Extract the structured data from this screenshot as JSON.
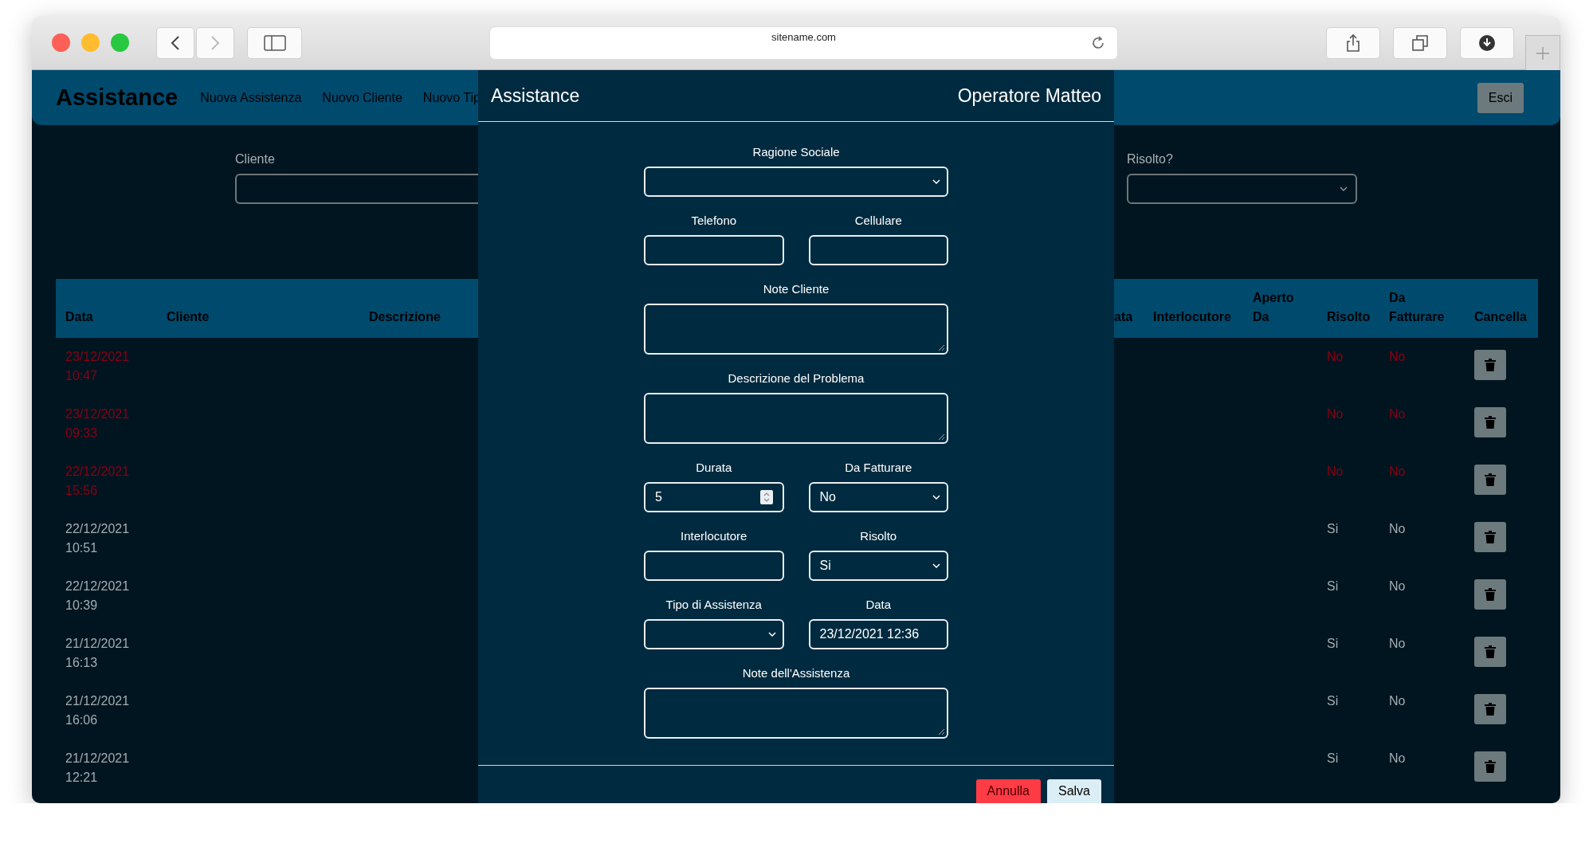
{
  "browser": {
    "url": "sitename.com"
  },
  "navbar": {
    "brand": "Assistance",
    "links": [
      "Nuova Assistenza",
      "Nuovo Cliente",
      "Nuovo Tip"
    ],
    "logout": "Esci"
  },
  "filters": [
    {
      "label": "Cliente",
      "kind": "text"
    },
    {
      "label": "Risolto?",
      "kind": "select"
    }
  ],
  "table": {
    "columns_left": [
      "Data",
      "Cliente",
      "Descrizione"
    ],
    "columns_right": [
      "ata",
      "Interlocutore",
      "Aperto Da",
      "Risolto",
      "Da Fatturare",
      "Cancella"
    ],
    "rows": [
      {
        "data": "23/12/2021 10:47",
        "risolto": "No",
        "da_fatturare": "No",
        "flagged": true
      },
      {
        "data": "23/12/2021 09:33",
        "risolto": "No",
        "da_fatturare": "No",
        "flagged": true
      },
      {
        "data": "22/12/2021 15:56",
        "risolto": "No",
        "da_fatturare": "No",
        "flagged": true
      },
      {
        "data": "22/12/2021 10:51",
        "risolto": "Si",
        "da_fatturare": "No",
        "flagged": false
      },
      {
        "data": "22/12/2021 10:39",
        "risolto": "Si",
        "da_fatturare": "No",
        "flagged": false
      },
      {
        "data": "21/12/2021 16:13",
        "risolto": "Si",
        "da_fatturare": "No",
        "flagged": false
      },
      {
        "data": "21/12/2021 16:06",
        "risolto": "Si",
        "da_fatturare": "No",
        "flagged": false
      },
      {
        "data": "21/12/2021 12:21",
        "risolto": "Si",
        "da_fatturare": "No",
        "flagged": false
      }
    ]
  },
  "modal": {
    "title": "Assistance",
    "operator": "Operatore Matteo",
    "rows": [
      [
        {
          "label": "Ragione Sociale",
          "kind": "select"
        }
      ],
      [
        {
          "label": "Telefono",
          "kind": "text"
        },
        {
          "label": "Cellulare",
          "kind": "text"
        }
      ],
      [
        {
          "label": "Note Cliente",
          "kind": "textarea"
        }
      ],
      [
        {
          "label": "Descrizione del Problema",
          "kind": "textarea"
        }
      ],
      [
        {
          "label": "Durata",
          "kind": "number",
          "value": "5"
        },
        {
          "label": "Da Fatturare",
          "kind": "select",
          "value": "No"
        }
      ],
      [
        {
          "label": "Interlocutore",
          "kind": "text"
        },
        {
          "label": "Risolto",
          "kind": "select",
          "value": "Si"
        }
      ],
      [
        {
          "label": "Tipo di Assistenza",
          "kind": "select"
        },
        {
          "label": "Data",
          "kind": "text",
          "value": "23/12/2021 12:36"
        }
      ],
      [
        {
          "label": "Note dell'Assistenza",
          "kind": "textarea"
        }
      ]
    ],
    "buttons": [
      {
        "label": "Annulla",
        "kind": "danger"
      },
      {
        "label": "Salva",
        "kind": "light"
      }
    ]
  }
}
